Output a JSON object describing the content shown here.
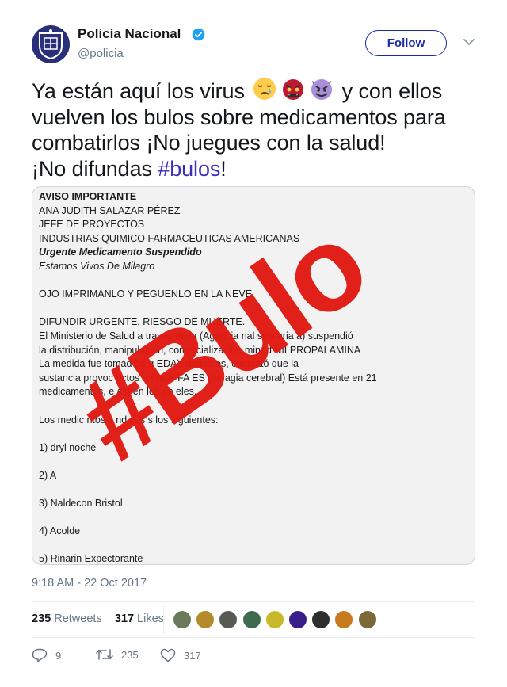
{
  "author": {
    "name": "Policía Nacional",
    "handle": "@policia",
    "verified": true
  },
  "follow_label": "Follow",
  "tweet": {
    "line1_prefix": "Ya están aquí los virus",
    "line1_suffix": "y con ellos",
    "line2": "vuelven los bulos sobre medicamentos para",
    "line3": "combatirlos ¡No juegues con la salud!",
    "line4_prefix": "¡No difundas ",
    "hashtag": "#bulos",
    "line4_suffix": "!",
    "emojis": [
      "sad-relieved-face",
      "ogre-mask",
      "smiling-imp"
    ]
  },
  "document": {
    "lines": [
      "AVISO IMPORTANTE",
      "ANA JUDITH SALAZAR PÉREZ",
      "JEFE DE PROYECTOS",
      "INDUSTRIAS QUIMICO FARMACEUTICAS AMERICANAS",
      "Urgente Medicamento Suspendido",
      "Estamos Vivos De Milagro",
      "",
      "OJO   IMPRIMANLO  Y PEGUENLO EN LA NEVE",
      "",
      "DIFUNDIR URGENTE, RIESGO DE MUERTE.",
      "El Ministerio de Salud a través de la (Agencia          nal           similaria          a) suspendió",
      "la distribución, manipulación, comercialización          minad           NILPROPALAMINA",
      "La medida fue tomad                        de q        EDA),          dados            os, constató que la",
      "sustancia provoc          ectos a      ersos FA        ES (he         agia cerebral) Está presente en 21",
      "medicamentos, e            almen          los an           eles.",
      "",
      "Los  medic          ntos s        ndidos s          los siguientes:",
      "",
      "1)         dryl          noche",
      "",
      "2) A",
      "",
      "3) Naldecon Bristol",
      "",
      "4) Acolde",
      "",
      "5) Rinarin Expectorante"
    ],
    "stamp": "#Bulo"
  },
  "timestamp": "9:18 AM - 22 Oct 2017",
  "stats": {
    "retweets_count": "235",
    "retweets_label": "Retweets",
    "likes_count": "317",
    "likes_label": "Likes"
  },
  "actions": {
    "replies": "9",
    "retweets": "235",
    "likes": "317"
  },
  "colors": {
    "link": "#1b2aa6",
    "hashtag": "#3a2fbd",
    "stamp_red": "#e11a12",
    "muted": "#657786"
  }
}
